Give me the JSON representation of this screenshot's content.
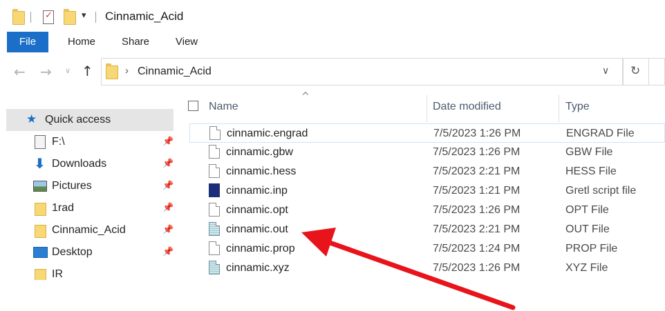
{
  "window": {
    "title": "Cinnamic_Acid"
  },
  "ribbon": {
    "tabs": [
      "File",
      "Home",
      "Share",
      "View"
    ]
  },
  "address": {
    "path_segment": "Cinnamic_Acid",
    "separator": "›"
  },
  "nav": {
    "items": [
      {
        "label": "Quick access",
        "icon": "star-icon",
        "pinned": false,
        "selected": true
      },
      {
        "label": "F:\\",
        "icon": "drive-icon",
        "pinned": true
      },
      {
        "label": "Downloads",
        "icon": "download-arrow-icon",
        "pinned": true
      },
      {
        "label": "Pictures",
        "icon": "pictures-icon",
        "pinned": true
      },
      {
        "label": "1rad",
        "icon": "folder-icon",
        "pinned": true
      },
      {
        "label": "Cinnamic_Acid",
        "icon": "folder-icon",
        "pinned": true
      },
      {
        "label": "Desktop",
        "icon": "desktop-icon",
        "pinned": true
      },
      {
        "label": "IR",
        "icon": "folder-icon",
        "pinned": false
      }
    ]
  },
  "columns": {
    "name": "Name",
    "date": "Date modified",
    "type": "Type"
  },
  "files": [
    {
      "name": "cinnamic.engrad",
      "date": "7/5/2023 1:26 PM",
      "type": "ENGRAD File",
      "icon": "file-icon"
    },
    {
      "name": "cinnamic.gbw",
      "date": "7/5/2023 1:26 PM",
      "type": "GBW File",
      "icon": "file-icon"
    },
    {
      "name": "cinnamic.hess",
      "date": "7/5/2023 2:21 PM",
      "type": "HESS File",
      "icon": "file-icon"
    },
    {
      "name": "cinnamic.inp",
      "date": "7/5/2023 1:21 PM",
      "type": "Gretl script file",
      "icon": "gretl-icon"
    },
    {
      "name": "cinnamic.opt",
      "date": "7/5/2023 1:26 PM",
      "type": "OPT File",
      "icon": "file-icon"
    },
    {
      "name": "cinnamic.out",
      "date": "7/5/2023 2:21 PM",
      "type": "OUT File",
      "icon": "text-file-icon"
    },
    {
      "name": "cinnamic.prop",
      "date": "7/5/2023 1:24 PM",
      "type": "PROP File",
      "icon": "file-icon"
    },
    {
      "name": "cinnamic.xyz",
      "date": "7/5/2023 1:26 PM",
      "type": "XYZ File",
      "icon": "text-file-icon"
    }
  ],
  "colors": {
    "accent": "#1b6fc8",
    "annotation_arrow": "#e8141b"
  }
}
